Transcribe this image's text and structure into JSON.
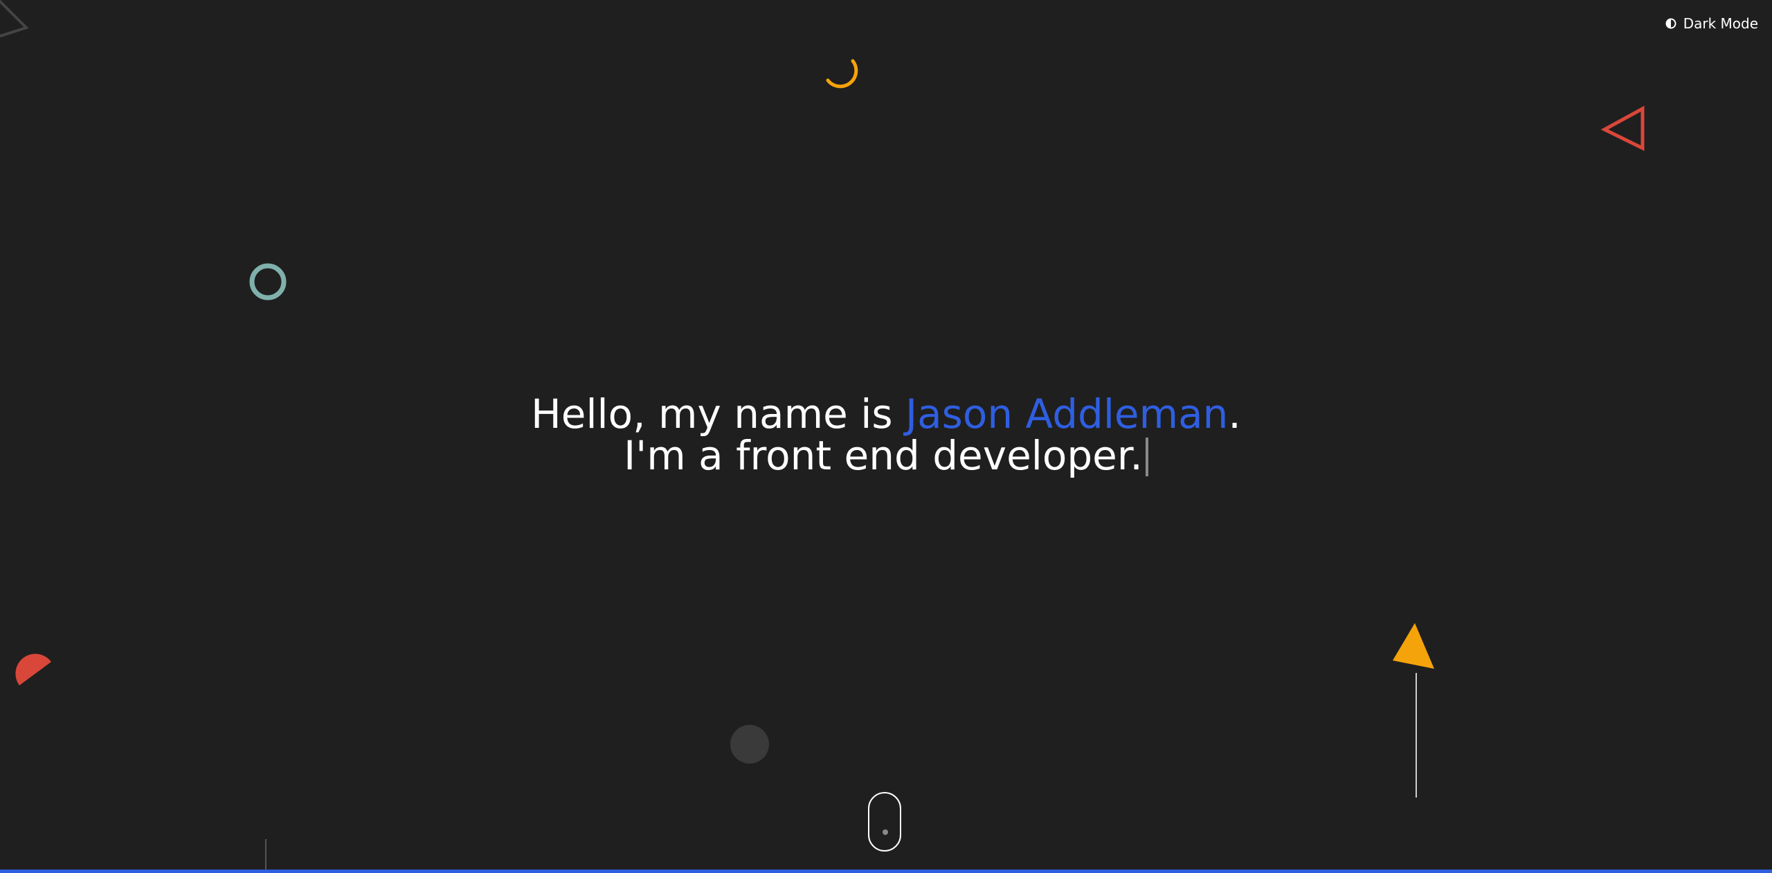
{
  "mode_toggle": {
    "label": "Dark Mode",
    "icon": "contrast-icon"
  },
  "hero": {
    "greeting": "Hello, my name is ",
    "name": "Jason Addleman",
    "period": ".",
    "tagline": "I'm a front end developer."
  },
  "colors": {
    "background": "#1f1f1f",
    "accent_blue": "#2f5ee0",
    "text": "#ffffff",
    "orange": "#f5a30b",
    "red": "#d9473a",
    "teal": "#7fb0ac",
    "gray": "#3a3a3a"
  }
}
